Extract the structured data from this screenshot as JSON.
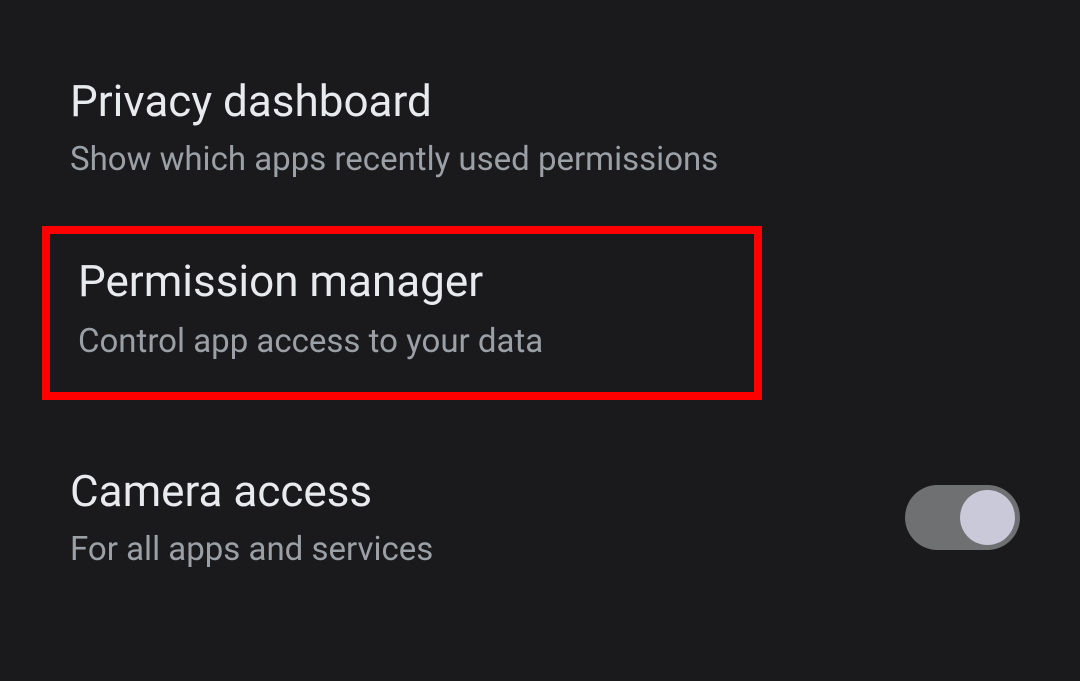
{
  "settings": {
    "privacy_dashboard": {
      "title": "Privacy dashboard",
      "subtitle": "Show which apps recently used permissions"
    },
    "permission_manager": {
      "title": "Permission manager",
      "subtitle": "Control app access to your data"
    },
    "camera_access": {
      "title": "Camera access",
      "subtitle": "For all apps and services",
      "toggle_state": "on"
    }
  }
}
